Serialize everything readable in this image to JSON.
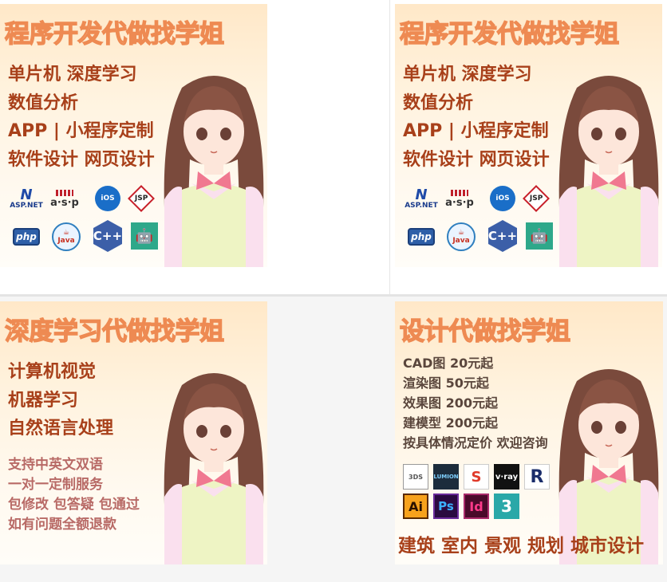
{
  "cards": {
    "dev_left": {
      "title": "程序开发代做找学姐",
      "lines": [
        "单片机 深度学习",
        "数值分析",
        "APP | 小程序定制",
        "软件设计 网页设计"
      ],
      "logos": [
        "aspnet-logo",
        "asp-logo",
        "ios-logo",
        "jsp-logo",
        "php-logo",
        "java-logo",
        "cpp-logo",
        "android-logo"
      ]
    },
    "dev_right": {
      "title": "程序开发代做找学姐",
      "lines": [
        "单片机 深度学习",
        "数值分析",
        "APP | 小程序定制",
        "软件设计 网页设计"
      ]
    },
    "deep_learning": {
      "title": "深度学习代做找学姐",
      "lines": [
        "计算机视觉",
        "机器学习",
        "自然语言处理"
      ],
      "sub_lines": [
        "支持中英文双语",
        "一对一定制服务",
        "包修改 包答疑 包通过",
        "如有问题全额退款"
      ]
    },
    "design": {
      "title": "设计代做找学姐",
      "prices": [
        "CAD图  20元起",
        "渲染图  50元起",
        "效果图  200元起",
        "建模型  200元起",
        "按具体情况定价 欢迎咨询"
      ],
      "software": [
        "3dsmax-logo",
        "lumion-logo",
        "sketchup-logo",
        "vray-logo",
        "revit-logo",
        "ai-logo",
        "ps-logo",
        "id-logo",
        "max-logo"
      ],
      "bottom": "建筑 室内 景观 规划 城市设计"
    }
  },
  "logo_text": {
    "aspnet": "ASP.NET",
    "asp": "a·s·p",
    "ios": "iOS",
    "jsp": "JSP",
    "php": "php",
    "java": "Java",
    "cpp": "C++",
    "lumion": "LUMION",
    "vray": "v·ray",
    "ai": "Ai",
    "ps": "Ps",
    "id": "Id",
    "max": "3"
  },
  "colors": {
    "title_fill": "#fbd2b7",
    "title_stroke": "#ee8a52",
    "headline": "#a8401a",
    "sub_text": "#b86a66"
  }
}
